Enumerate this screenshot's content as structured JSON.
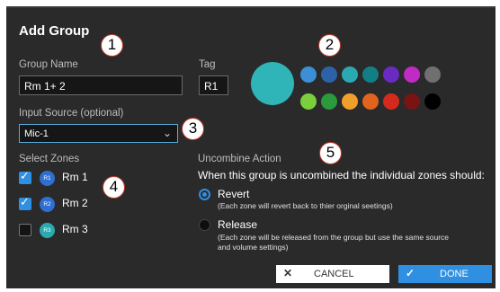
{
  "dialog": {
    "title": "Add Group",
    "group_name": {
      "label": "Group Name",
      "value": "Rm 1+ 2"
    },
    "tag": {
      "label": "Tag",
      "value": "R1"
    },
    "input_source": {
      "label": "Input Source (optional)",
      "value": "Mic-1"
    },
    "colors": {
      "selected": "#2fb5b8",
      "palette": [
        "#3c8fd6",
        "#2e62a8",
        "#2aaab0",
        "#127f85",
        "#6a2bc4",
        "#c02bc4",
        "#707070",
        "#7ccf3c",
        "#2b9a3c",
        "#f0a02a",
        "#e0641e",
        "#d42a1e",
        "#7a1414",
        "#000000"
      ]
    },
    "zones": {
      "label": "Select Zones",
      "items": [
        {
          "tag": "R1",
          "name": "Rm 1",
          "checked": true,
          "color": "#2f6fd0"
        },
        {
          "tag": "R2",
          "name": "Rm 2",
          "checked": true,
          "color": "#2f6fd0"
        },
        {
          "tag": "R3",
          "name": "Rm 3",
          "checked": false,
          "color": "#2aaab0"
        }
      ]
    },
    "uncombine": {
      "label": "Uncombine Action",
      "prompt": "When this group is uncombined the individual zones should:",
      "options": [
        {
          "title": "Revert",
          "desc": "(Each zone will revert back to thier orginal seetings)",
          "selected": true
        },
        {
          "title": "Release",
          "desc1": "(Each zone will be released from the group but use the same source",
          "desc2": "and volume settings)",
          "selected": false
        }
      ]
    },
    "buttons": {
      "cancel": "CANCEL",
      "done": "DONE"
    },
    "callouts": [
      "1",
      "2",
      "3",
      "4",
      "5"
    ]
  }
}
